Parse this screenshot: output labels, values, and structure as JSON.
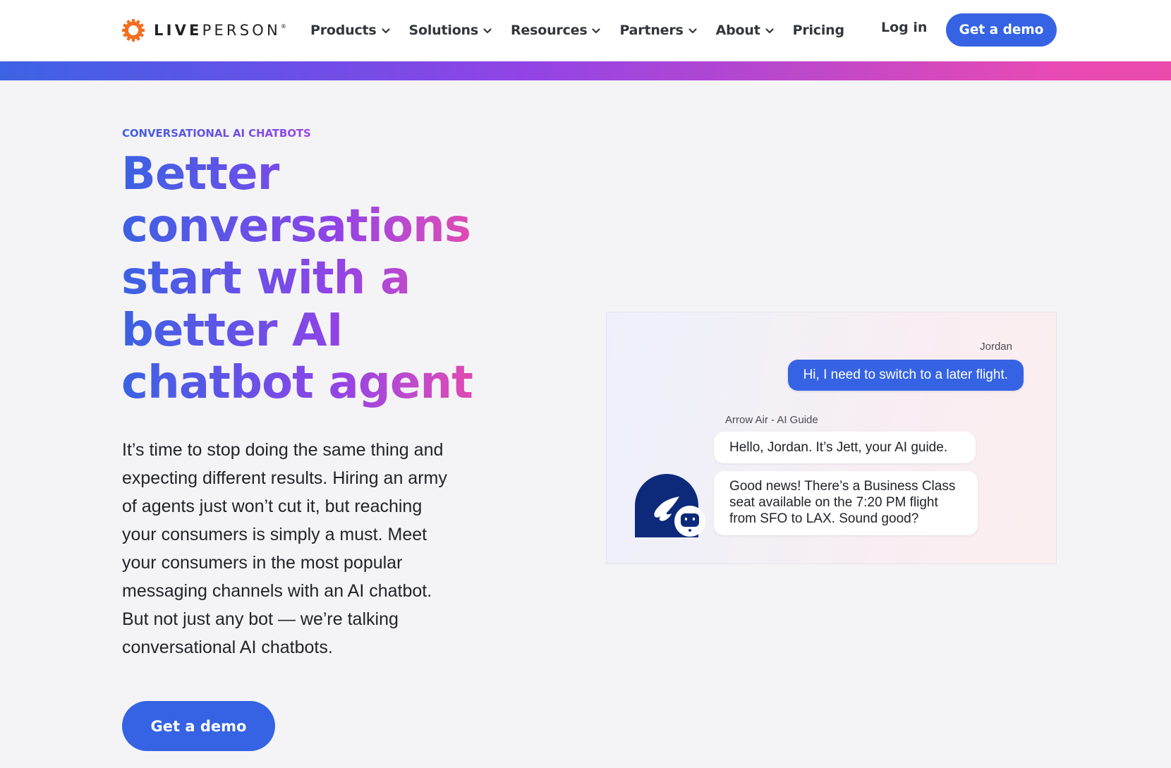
{
  "brand": {
    "name_bold": "LIVE",
    "name_light": "PERSON",
    "registered_mark": "®",
    "logo_icon": "gear-sun-icon",
    "logo_color": "#f26f21"
  },
  "nav": {
    "items": [
      {
        "label": "Products",
        "has_dropdown": true
      },
      {
        "label": "Solutions",
        "has_dropdown": true
      },
      {
        "label": "Resources",
        "has_dropdown": true
      },
      {
        "label": "Partners",
        "has_dropdown": true
      },
      {
        "label": "About",
        "has_dropdown": true
      },
      {
        "label": "Pricing",
        "has_dropdown": false
      }
    ],
    "login_label": "Log in",
    "cta_label": "Get a demo"
  },
  "colors": {
    "primary": "#3563e3",
    "gradient_start": "#3d63e3",
    "gradient_mid": "#9244e6",
    "gradient_end": "#ea4aac",
    "bot_avatar": "#0d2a7a"
  },
  "hero": {
    "eyebrow": "CONVERSATIONAL AI CHATBOTS",
    "headline_lines": [
      "Better",
      "conversations",
      "start with a",
      "better AI",
      "chatbot agent"
    ],
    "body_lines": [
      "It’s time to stop doing the same thing and",
      "expecting different results. Hiring an army",
      "of agents just won’t cut it, but reaching",
      "your consumers is simply a must. Meet",
      "your consumers in the most popular",
      "messaging channels with an AI chatbot.",
      "But not just any bot — we’re talking",
      "conversational AI chatbots."
    ],
    "cta_label": "Get a demo"
  },
  "chat": {
    "user_name": "Jordan",
    "user_message": "Hi, I need to switch to a later flight.",
    "bot_name": "Arrow Air - AI Guide",
    "bot_message_1": "Hello, Jordan. It’s Jett, your AI guide.",
    "bot_message_2_lines": [
      "Good news! There’s a Business Class",
      "seat available on the 7:20 PM flight",
      "from SFO to LAX. Sound good?"
    ],
    "bot_avatar_icon": "winged-arrow-icon",
    "bot_badge_icon": "robot-face-icon"
  }
}
